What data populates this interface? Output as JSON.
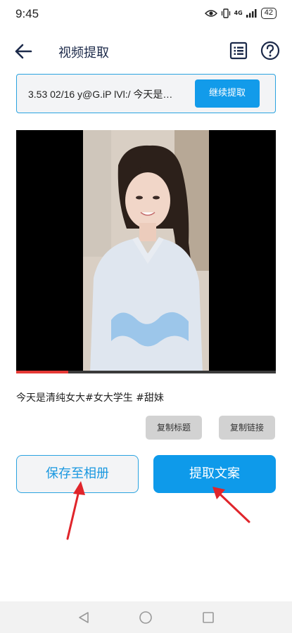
{
  "status_bar": {
    "time": "9:45",
    "network": "4G",
    "battery": "42"
  },
  "header": {
    "title": "视频提取",
    "back_icon": "back-arrow-icon",
    "list_icon": "list-icon",
    "help_icon": "help-icon"
  },
  "link_bar": {
    "text": "3.53 02/16 y@G.iP lVl:/ 今天是…",
    "continue_label": "继续提取"
  },
  "video": {
    "progress_fraction": 0.2,
    "progress_color": "#e53935"
  },
  "caption": "今天是清纯女大#女大学生 #甜妹",
  "actions": {
    "copy_title": "复制标题",
    "copy_link": "复制链接",
    "save_album": "保存至相册",
    "extract_text": "提取文案"
  },
  "colors": {
    "accent": "#129bea",
    "title": "#1c2a4a",
    "annotation": "#e0252b"
  }
}
